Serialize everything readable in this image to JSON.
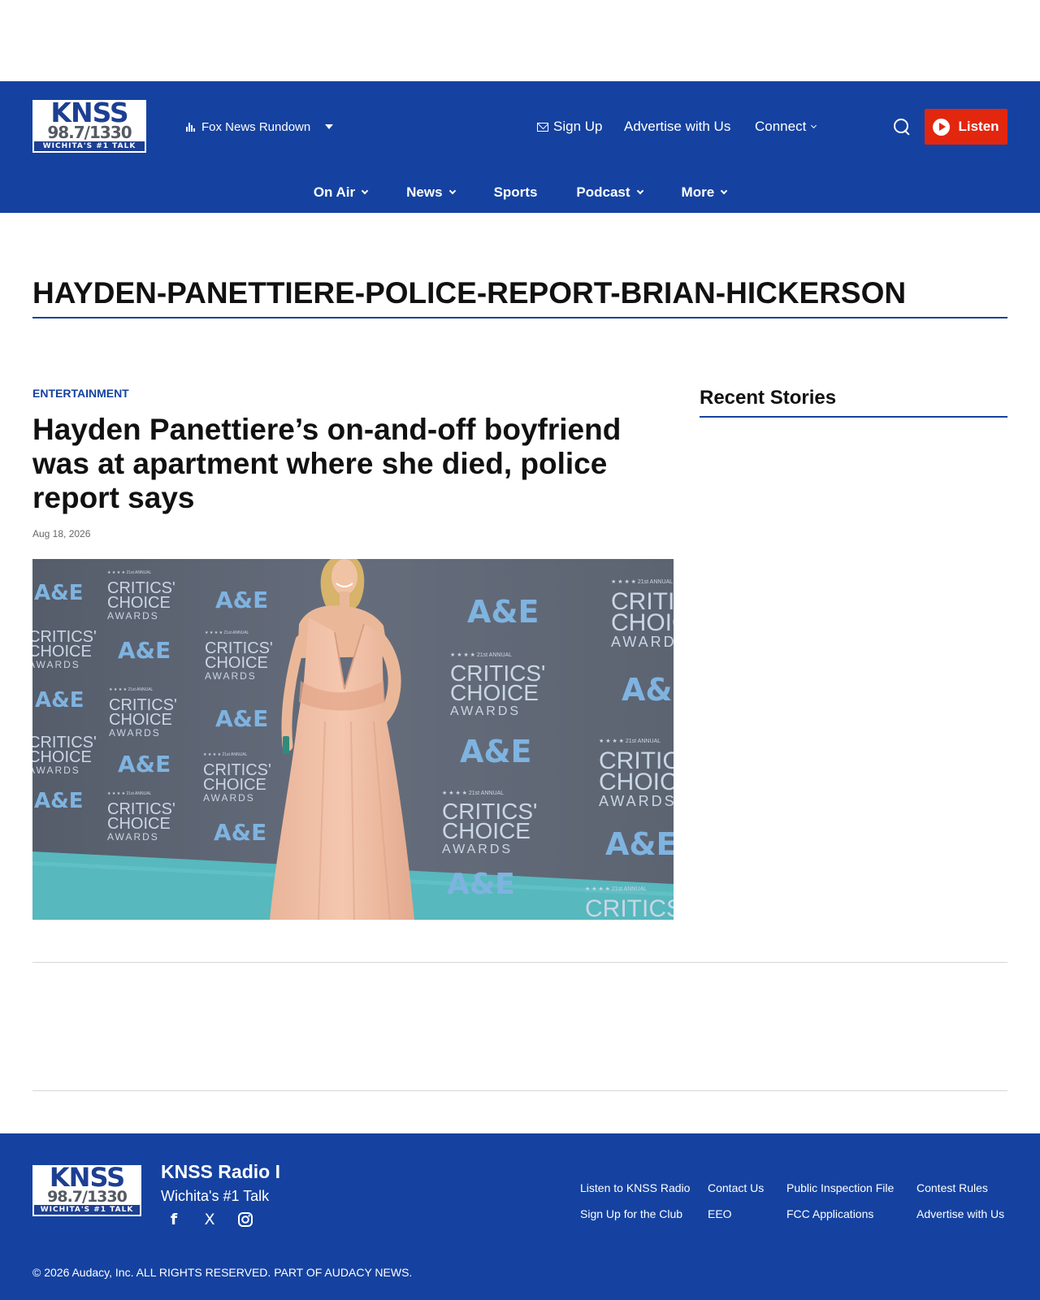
{
  "brand": {
    "logo_line1": "KNSS",
    "logo_line2": "98.7/1330",
    "logo_line3": "WICHITA'S #1 TALK",
    "primary_color": "#1542a0",
    "accent_color": "#e3260e"
  },
  "header": {
    "now_playing": "Fox News Rundown",
    "sign_up": "Sign Up",
    "advertise": "Advertise with Us",
    "connect": "Connect",
    "listen": "Listen",
    "icons": [
      "equalizer-icon",
      "caret-down-icon",
      "mail-icon",
      "chevron-down-icon",
      "search-icon",
      "play-icon"
    ]
  },
  "nav": {
    "items": [
      {
        "label": "On Air",
        "has_dropdown": true
      },
      {
        "label": "News",
        "has_dropdown": true
      },
      {
        "label": "Sports",
        "has_dropdown": false
      },
      {
        "label": "Podcast",
        "has_dropdown": true
      },
      {
        "label": "More",
        "has_dropdown": true
      }
    ]
  },
  "page": {
    "title": "HAYDEN-PANETTIERE-POLICE-REPORT-BRIAN-HICKERSON"
  },
  "article": {
    "category": "ENTERTAINMENT",
    "title": "Hayden Panettiere’s on-and-off boyfriend was at apartment where she died, police report says",
    "date": "Aug 18, 2026",
    "image_backdrop": {
      "logo_text": "A&E",
      "award_line1": "CRITICS'",
      "award_line2": "CHOICE",
      "award_line3": "AWARDS",
      "edition": "★ ★ ★ ★ 21st ANNUAL"
    }
  },
  "sidebar": {
    "recent_title": "Recent Stories"
  },
  "footer": {
    "station_name": "KNSS Radio I",
    "tagline": "Wichita's #1 Talk",
    "social_icons": [
      "facebook-icon",
      "x-icon",
      "instagram-icon"
    ],
    "social_glyphs": {
      "facebook": "f",
      "x": "X"
    },
    "links": [
      "Listen to KNSS Radio",
      "Contact Us",
      "Public Inspection File",
      "Contest Rules",
      "Sign Up for the Club",
      "EEO",
      "FCC Applications",
      "Advertise with Us"
    ],
    "copyright": "© 2026 Audacy, Inc. ALL RIGHTS RESERVED. PART OF AUDACY NEWS."
  }
}
